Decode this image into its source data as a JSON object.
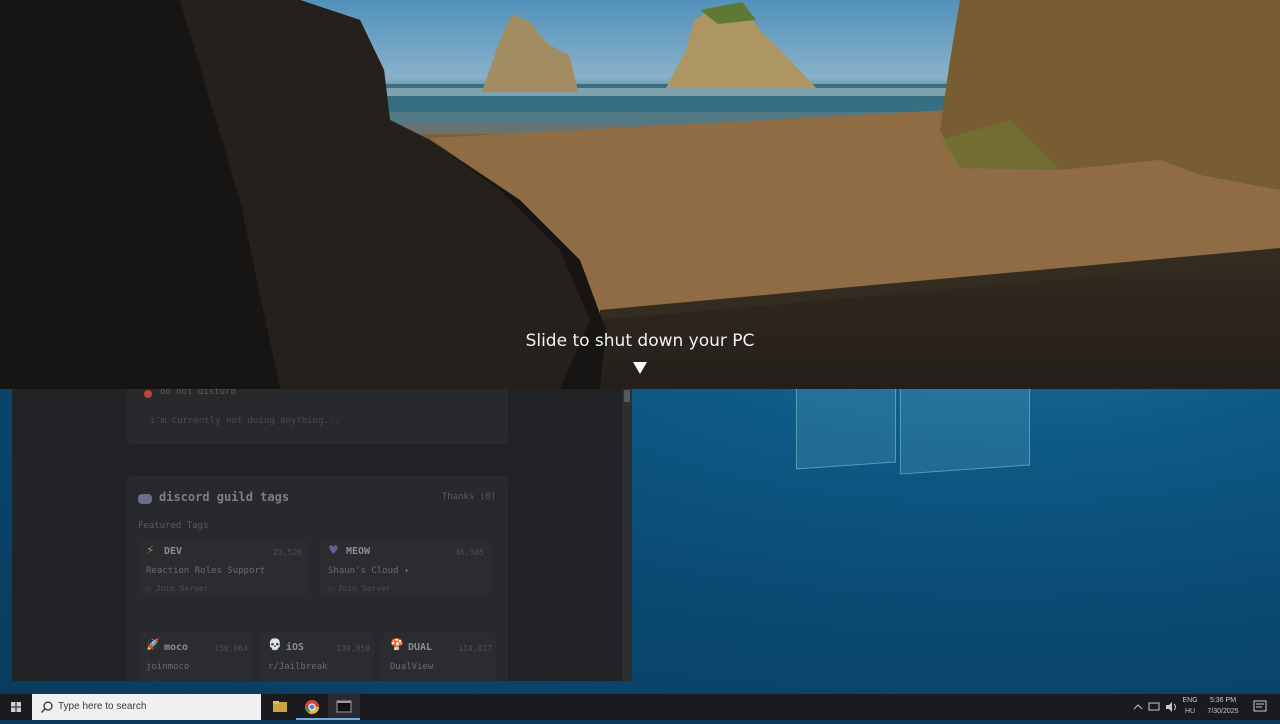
{
  "lock_screen": {
    "prompt": "Slide to shut down your PC"
  },
  "app_window": {
    "status_text": "do not disturb",
    "activity_text": "i'm currently not doing anything...",
    "guild_section": {
      "title": "discord guild tags",
      "thanks": "Thanks (0)",
      "featured_label": "Featured Tags",
      "featured_tags": [
        {
          "name": "DEV",
          "count": "23,526",
          "description": "Reaction Roles Support",
          "action": "Join Server",
          "icon": "lightning-icon"
        },
        {
          "name": "MEOW",
          "count": "46,305",
          "description": "Shaun's Cloud ✦",
          "action": "Join Server",
          "icon": "heart-icon"
        }
      ],
      "tags": [
        {
          "name": "moco",
          "count": "150,064",
          "description": "joinmoco",
          "icon": "rocket-icon"
        },
        {
          "name": "iOS",
          "count": "139,959",
          "description": "r/Jailbreak",
          "icon": "skull-icon"
        },
        {
          "name": "DUAL",
          "count": "114,017",
          "description": "DualView",
          "icon": "mushroom-icon"
        }
      ]
    }
  },
  "taskbar": {
    "search_placeholder": "Type here to search",
    "language_top": "ENG",
    "language_bottom": "HU",
    "time": "5:36 PM",
    "date": "7/30/2025"
  },
  "colors": {
    "status_dnd": "#e0453d",
    "taskbar_bg": "#1b1b1f",
    "desktop_accent": "#0e5a86"
  }
}
